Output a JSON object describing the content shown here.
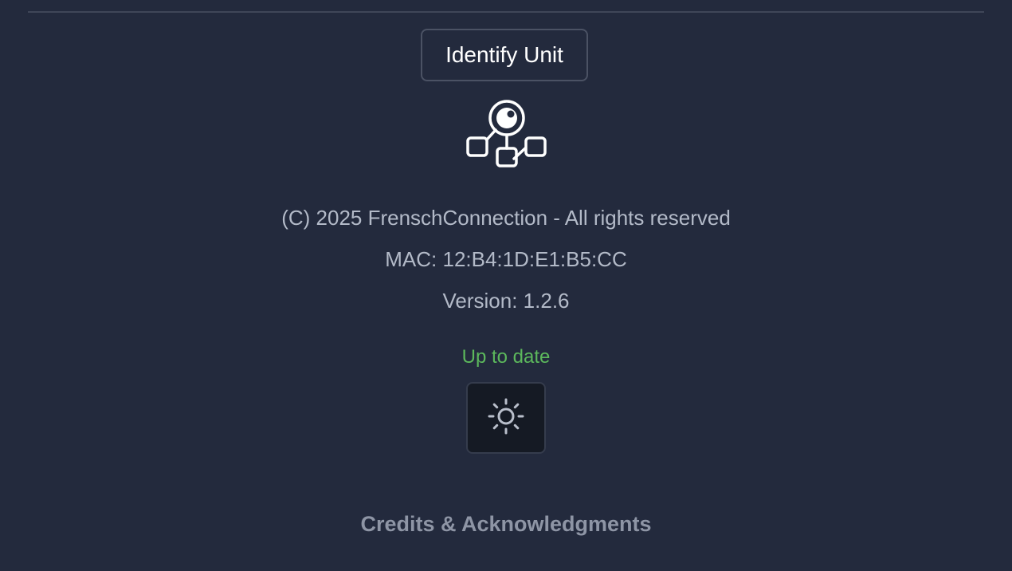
{
  "identify_button": {
    "label": "Identify Unit"
  },
  "logo": {
    "icon": "network-hub-icon"
  },
  "info": {
    "copyright": "(C) 2025 FrenschConnection - All rights reserved",
    "mac": "MAC: 12:B4:1D:E1:B5:CC",
    "version": "Version: 1.2.6"
  },
  "update_status": {
    "text": "Up to date",
    "color": "#5cb85c"
  },
  "theme_toggle": {
    "icon": "sun-icon"
  },
  "credits": {
    "label": "Credits & Acknowledgments"
  },
  "colors": {
    "background": "#232a3d",
    "text": "#b3bac8",
    "button_border": "#4b5264"
  }
}
